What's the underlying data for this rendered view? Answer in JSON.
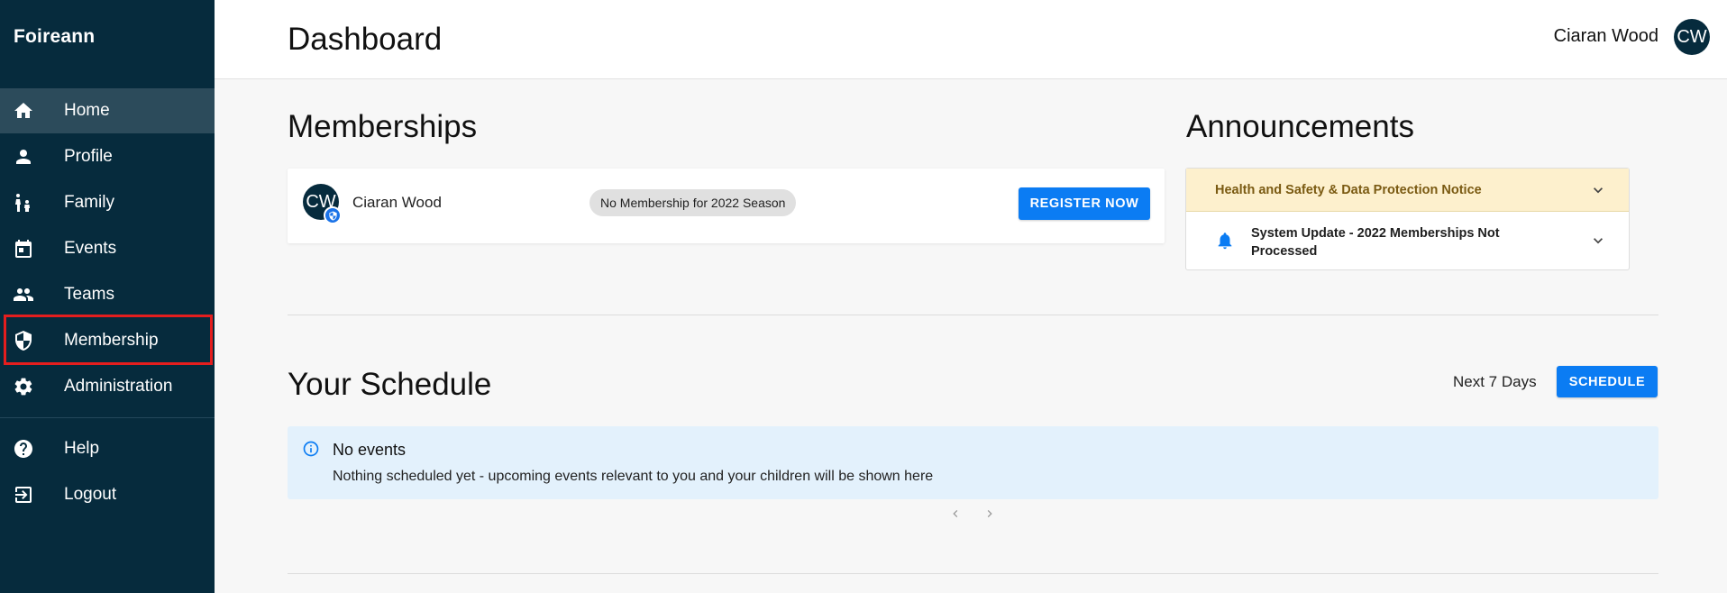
{
  "app": {
    "name": "Foireann"
  },
  "sidebar": {
    "items": [
      {
        "label": "Home",
        "icon": "home-icon"
      },
      {
        "label": "Profile",
        "icon": "person-icon"
      },
      {
        "label": "Family",
        "icon": "family-icon"
      },
      {
        "label": "Events",
        "icon": "calendar-icon"
      },
      {
        "label": "Teams",
        "icon": "group-icon"
      },
      {
        "label": "Membership",
        "icon": "shield-icon"
      },
      {
        "label": "Administration",
        "icon": "gear-icon"
      },
      {
        "label": "Help",
        "icon": "help-icon"
      },
      {
        "label": "Logout",
        "icon": "logout-icon"
      }
    ],
    "active_item": "Home",
    "highlighted_item": "Membership"
  },
  "header": {
    "title": "Dashboard",
    "user_name": "Ciaran Wood",
    "avatar_initials": "CW"
  },
  "memberships": {
    "title": "Memberships",
    "member": {
      "initials": "CW",
      "name": "Ciaran Wood",
      "status": "No Membership for 2022 Season",
      "action_label": "REGISTER NOW"
    }
  },
  "announcements": {
    "title": "Announcements",
    "items": [
      {
        "text": "Health and Safety & Data Protection Notice"
      },
      {
        "text": "System Update - 2022 Memberships Not Processed"
      }
    ]
  },
  "schedule": {
    "title": "Your Schedule",
    "range_label": "Next 7 Days",
    "button_label": "SCHEDULE",
    "empty_title": "No events",
    "empty_text": "Nothing scheduled yet - upcoming events relevant to you and your children will be shown here"
  },
  "colors": {
    "sidebar_bg": "#062b3d",
    "accent": "#0b7cf3",
    "notice_bg": "#fdf0cd",
    "info_bg": "#e3f1fc",
    "highlight": "#e41e1e"
  }
}
